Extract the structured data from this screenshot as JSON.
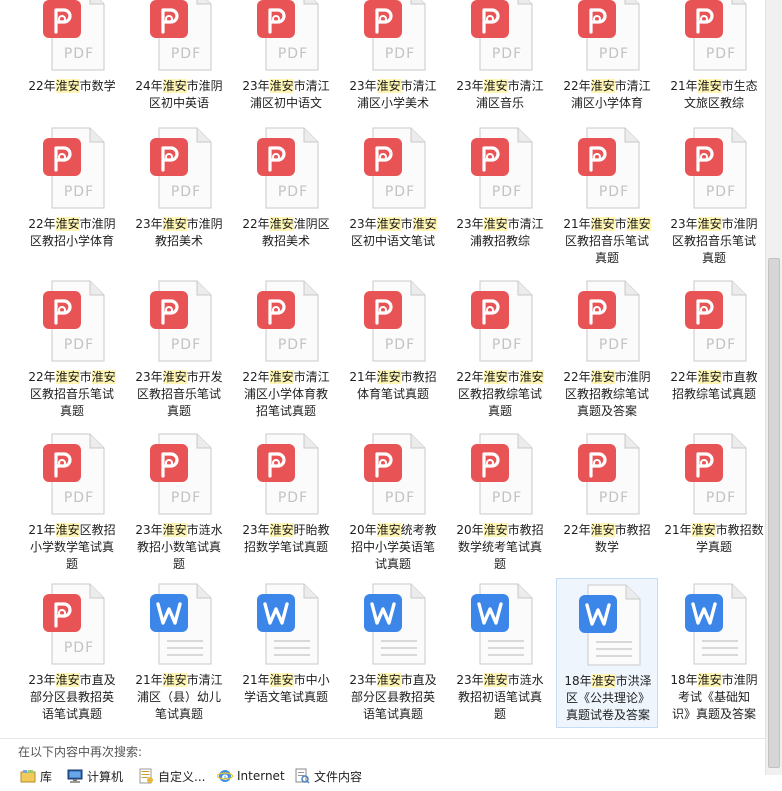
{
  "files": [
    {
      "type": "pdf",
      "lines": [
        [
          [
            "22年",
            false
          ],
          [
            "淮安",
            true
          ],
          [
            "市数学",
            false
          ]
        ]
      ]
    },
    {
      "type": "pdf",
      "lines": [
        [
          [
            "24年",
            false
          ],
          [
            "淮安",
            true
          ],
          [
            "市淮阴",
            false
          ]
        ],
        [
          [
            "区初中英语",
            false
          ]
        ]
      ]
    },
    {
      "type": "pdf",
      "lines": [
        [
          [
            "23年",
            false
          ],
          [
            "淮安",
            true
          ],
          [
            "市清江",
            false
          ]
        ],
        [
          [
            "浦区初中语文",
            false
          ]
        ]
      ]
    },
    {
      "type": "pdf",
      "lines": [
        [
          [
            "23年",
            false
          ],
          [
            "淮安",
            true
          ],
          [
            "市清江",
            false
          ]
        ],
        [
          [
            "浦区小学美术",
            false
          ]
        ]
      ]
    },
    {
      "type": "pdf",
      "lines": [
        [
          [
            "23年",
            false
          ],
          [
            "淮安",
            true
          ],
          [
            "市清江",
            false
          ]
        ],
        [
          [
            "浦区音乐",
            false
          ]
        ]
      ]
    },
    {
      "type": "pdf",
      "lines": [
        [
          [
            "22年",
            false
          ],
          [
            "淮安",
            true
          ],
          [
            "市清江",
            false
          ]
        ],
        [
          [
            "浦区小学体育",
            false
          ]
        ]
      ]
    },
    {
      "type": "pdf",
      "lines": [
        [
          [
            "21年",
            false
          ],
          [
            "淮安",
            true
          ],
          [
            "市生态",
            false
          ]
        ],
        [
          [
            "文旅区教综",
            false
          ]
        ]
      ]
    },
    {
      "type": "pdf",
      "lines": [
        [
          [
            "22年",
            false
          ],
          [
            "淮安",
            true
          ],
          [
            "市淮阴",
            false
          ]
        ],
        [
          [
            "区教招小学体育",
            false
          ]
        ]
      ]
    },
    {
      "type": "pdf",
      "lines": [
        [
          [
            "23年",
            false
          ],
          [
            "淮安",
            true
          ],
          [
            "市淮阴",
            false
          ]
        ],
        [
          [
            "教招美术",
            false
          ]
        ]
      ]
    },
    {
      "type": "pdf",
      "lines": [
        [
          [
            "22年",
            false
          ],
          [
            "淮安",
            true
          ],
          [
            "淮阴区",
            false
          ]
        ],
        [
          [
            "教招美术",
            false
          ]
        ]
      ]
    },
    {
      "type": "pdf",
      "lines": [
        [
          [
            "23年",
            false
          ],
          [
            "淮安",
            true
          ],
          [
            "市",
            false
          ],
          [
            "淮安",
            true
          ]
        ],
        [
          [
            "区初中语文笔试",
            false
          ]
        ]
      ]
    },
    {
      "type": "pdf",
      "lines": [
        [
          [
            "23年",
            false
          ],
          [
            "淮安",
            true
          ],
          [
            "市清江",
            false
          ]
        ],
        [
          [
            "浦教招教综",
            false
          ]
        ]
      ]
    },
    {
      "type": "pdf",
      "lines": [
        [
          [
            "21年",
            false
          ],
          [
            "淮安",
            true
          ],
          [
            "市",
            false
          ],
          [
            "淮安",
            true
          ]
        ],
        [
          [
            "区教招音乐笔试",
            false
          ]
        ],
        [
          [
            "真题",
            false
          ]
        ]
      ]
    },
    {
      "type": "pdf",
      "lines": [
        [
          [
            "23年",
            false
          ],
          [
            "淮安",
            true
          ],
          [
            "市淮阴",
            false
          ]
        ],
        [
          [
            "区教招音乐笔试",
            false
          ]
        ],
        [
          [
            "真题",
            false
          ]
        ]
      ]
    },
    {
      "type": "pdf",
      "lines": [
        [
          [
            "22年",
            false
          ],
          [
            "淮安",
            true
          ],
          [
            "市",
            false
          ],
          [
            "淮安",
            true
          ]
        ],
        [
          [
            "区教招音乐笔试",
            false
          ]
        ],
        [
          [
            "真题",
            false
          ]
        ]
      ]
    },
    {
      "type": "pdf",
      "lines": [
        [
          [
            "23年",
            false
          ],
          [
            "淮安",
            true
          ],
          [
            "市开发",
            false
          ]
        ],
        [
          [
            "区教招音乐笔试",
            false
          ]
        ],
        [
          [
            "真题",
            false
          ]
        ]
      ]
    },
    {
      "type": "pdf",
      "lines": [
        [
          [
            "22年",
            false
          ],
          [
            "淮安",
            true
          ],
          [
            "市清江",
            false
          ]
        ],
        [
          [
            "浦区小学体育教",
            false
          ]
        ],
        [
          [
            "招笔试真题",
            false
          ]
        ]
      ]
    },
    {
      "type": "pdf",
      "lines": [
        [
          [
            "21年",
            false
          ],
          [
            "淮安",
            true
          ],
          [
            "市教招",
            false
          ]
        ],
        [
          [
            "体育笔试真题",
            false
          ]
        ]
      ]
    },
    {
      "type": "pdf",
      "lines": [
        [
          [
            "22年",
            false
          ],
          [
            "淮安",
            true
          ],
          [
            "市",
            false
          ],
          [
            "淮安",
            true
          ]
        ],
        [
          [
            "区教招教综笔试",
            false
          ]
        ],
        [
          [
            "真题",
            false
          ]
        ]
      ]
    },
    {
      "type": "pdf",
      "lines": [
        [
          [
            "22年",
            false
          ],
          [
            "淮安",
            true
          ],
          [
            "市淮阴",
            false
          ]
        ],
        [
          [
            "区教招教综笔试",
            false
          ]
        ],
        [
          [
            "真题及答案",
            false
          ]
        ]
      ]
    },
    {
      "type": "pdf",
      "lines": [
        [
          [
            "22年",
            false
          ],
          [
            "淮安",
            true
          ],
          [
            "市直教",
            false
          ]
        ],
        [
          [
            "招教综笔试真题",
            false
          ]
        ]
      ]
    },
    {
      "type": "pdf",
      "lines": [
        [
          [
            "21年",
            false
          ],
          [
            "淮安",
            true
          ],
          [
            "区教招",
            false
          ]
        ],
        [
          [
            "小学数学笔试真",
            false
          ]
        ],
        [
          [
            "题",
            false
          ]
        ]
      ]
    },
    {
      "type": "pdf",
      "lines": [
        [
          [
            "23年",
            false
          ],
          [
            "淮安",
            true
          ],
          [
            "市涟水",
            false
          ]
        ],
        [
          [
            "教招小数笔试真",
            false
          ]
        ],
        [
          [
            "题",
            false
          ]
        ]
      ]
    },
    {
      "type": "pdf",
      "lines": [
        [
          [
            "23年",
            false
          ],
          [
            "淮安",
            true
          ],
          [
            "盱眙教",
            false
          ]
        ],
        [
          [
            "招数学笔试真题",
            false
          ]
        ]
      ]
    },
    {
      "type": "pdf",
      "lines": [
        [
          [
            "20年",
            false
          ],
          [
            "淮安",
            true
          ],
          [
            "统考教",
            false
          ]
        ],
        [
          [
            "招中小学英语笔",
            false
          ]
        ],
        [
          [
            "试真题",
            false
          ]
        ]
      ]
    },
    {
      "type": "pdf",
      "lines": [
        [
          [
            "20年",
            false
          ],
          [
            "淮安",
            true
          ],
          [
            "市教招",
            false
          ]
        ],
        [
          [
            "数学统考笔试真",
            false
          ]
        ],
        [
          [
            "题",
            false
          ]
        ]
      ]
    },
    {
      "type": "pdf",
      "lines": [
        [
          [
            "22年",
            false
          ],
          [
            "淮安",
            true
          ],
          [
            "市教招",
            false
          ]
        ],
        [
          [
            "数学",
            false
          ]
        ]
      ]
    },
    {
      "type": "pdf",
      "lines": [
        [
          [
            "21年",
            false
          ],
          [
            "淮安",
            true
          ],
          [
            "市教招数",
            false
          ]
        ],
        [
          [
            "学真题",
            false
          ]
        ]
      ]
    },
    {
      "type": "pdf",
      "lines": [
        [
          [
            "23年",
            false
          ],
          [
            "淮安",
            true
          ],
          [
            "市直及",
            false
          ]
        ],
        [
          [
            "部分区县教招英",
            false
          ]
        ],
        [
          [
            "语笔试真题",
            false
          ]
        ]
      ]
    },
    {
      "type": "word",
      "lines": [
        [
          [
            "21年",
            false
          ],
          [
            "淮安",
            true
          ],
          [
            "市清江",
            false
          ]
        ],
        [
          [
            "浦区（县）幼儿",
            false
          ]
        ],
        [
          [
            "笔试真题",
            false
          ]
        ]
      ]
    },
    {
      "type": "word",
      "lines": [
        [
          [
            "21年",
            false
          ],
          [
            "淮安",
            true
          ],
          [
            "市中小",
            false
          ]
        ],
        [
          [
            "学语文笔试真题",
            false
          ]
        ]
      ]
    },
    {
      "type": "word",
      "lines": [
        [
          [
            "23年",
            false
          ],
          [
            "淮安",
            true
          ],
          [
            "市直及",
            false
          ]
        ],
        [
          [
            "部分区县教招英",
            false
          ]
        ],
        [
          [
            "语笔试真题",
            false
          ]
        ]
      ]
    },
    {
      "type": "word",
      "lines": [
        [
          [
            "23年",
            false
          ],
          [
            "淮安",
            true
          ],
          [
            "市涟水",
            false
          ]
        ],
        [
          [
            "教招初语笔试真",
            false
          ]
        ],
        [
          [
            "题",
            false
          ]
        ]
      ]
    },
    {
      "type": "word",
      "selected": true,
      "lines": [
        [
          [
            "18年",
            false
          ],
          [
            "淮安",
            true
          ],
          [
            "市洪泽",
            false
          ]
        ],
        [
          [
            "区《公共理论》",
            false
          ]
        ],
        [
          [
            "真题试卷及答案",
            false
          ]
        ]
      ]
    },
    {
      "type": "word",
      "lines": [
        [
          [
            "18年",
            false
          ],
          [
            "淮安",
            true
          ],
          [
            "市淮阴",
            false
          ]
        ],
        [
          [
            "考试《基础知",
            false
          ]
        ],
        [
          [
            "识》真题及答案",
            false
          ]
        ]
      ]
    }
  ],
  "icon_text": {
    "pdf": "PDF"
  },
  "colors": {
    "pdf_badge": "#e85456",
    "word_badge": "#3b86e8",
    "highlight": "#fff5b4"
  },
  "search_again": {
    "label": "在以下内容中再次搜索:",
    "locations": [
      {
        "label": "库",
        "icon": "library-icon"
      },
      {
        "label": "计算机",
        "icon": "computer-icon"
      },
      {
        "label": "自定义...",
        "icon": "custom-folder-icon"
      },
      {
        "label": "Internet",
        "icon": "internet-icon"
      },
      {
        "label": "文件内容",
        "icon": "file-contents-icon"
      }
    ]
  }
}
